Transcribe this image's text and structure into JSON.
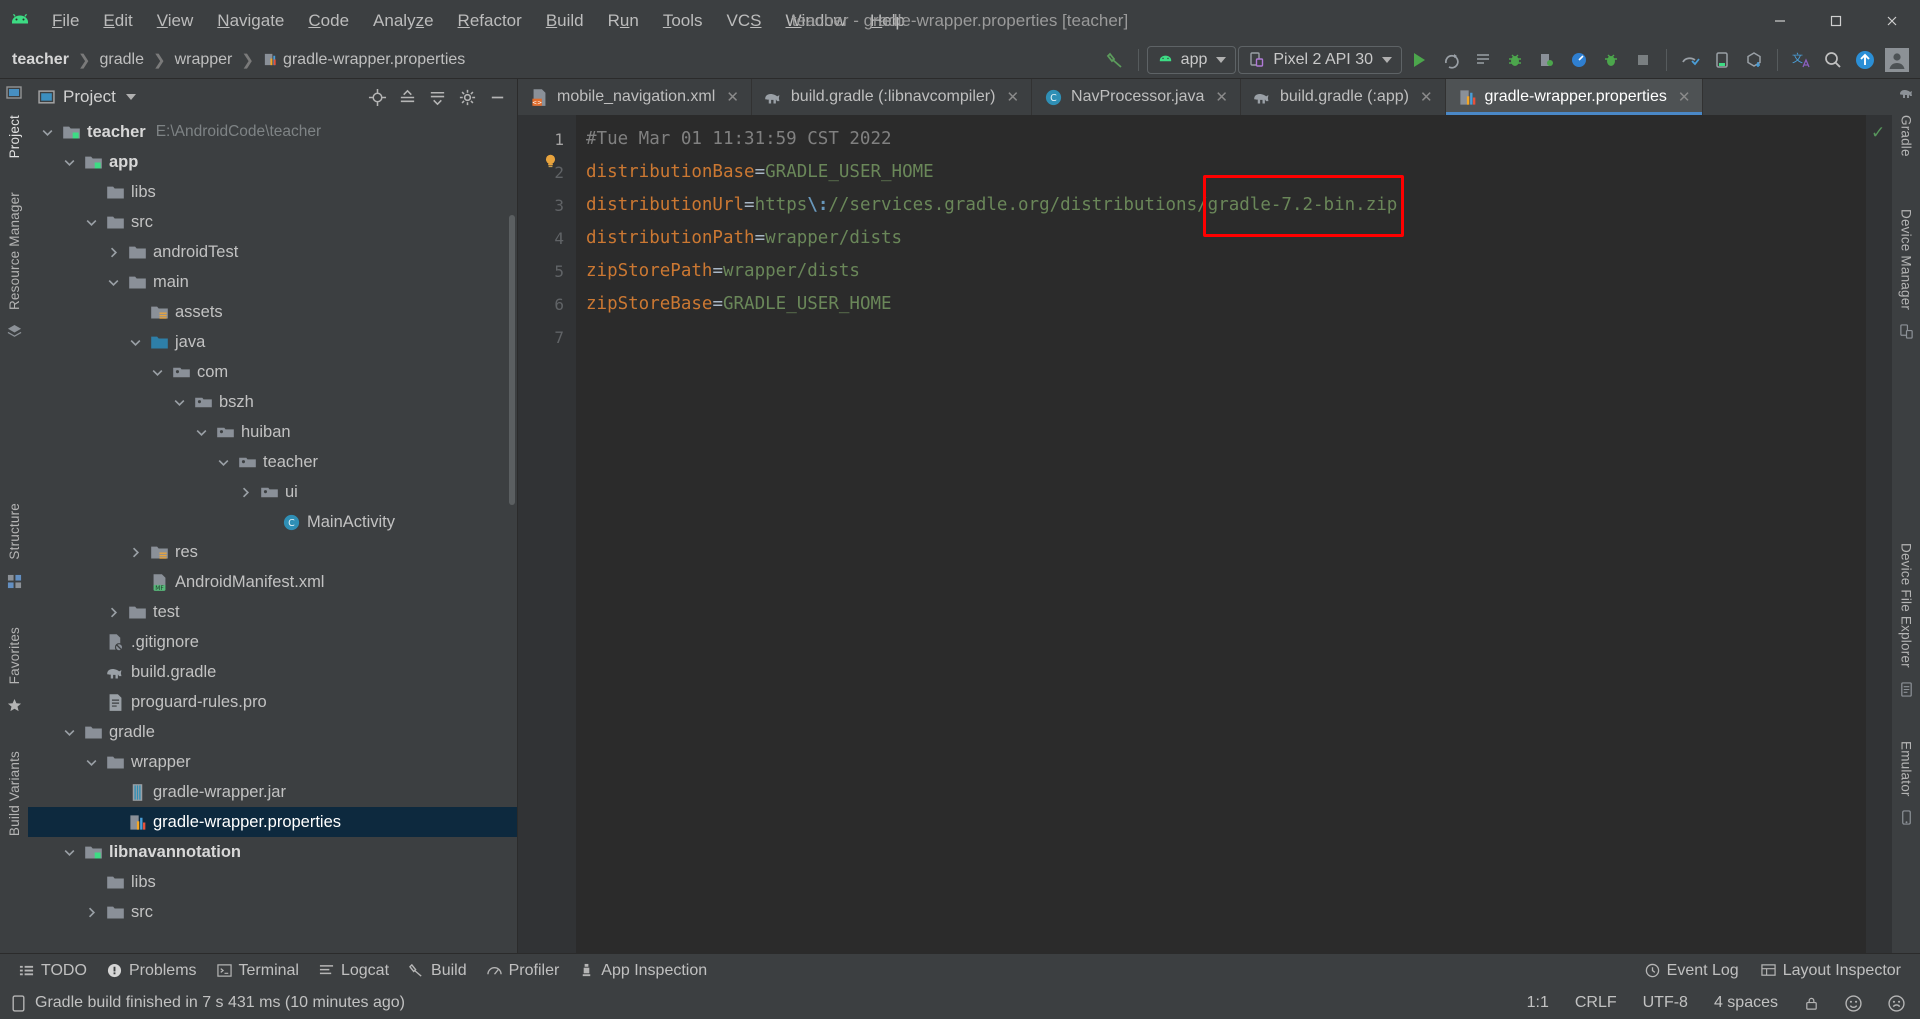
{
  "window": {
    "title": "teacher - gradle-wrapper.properties [teacher]",
    "minimize": "–",
    "maximize": "▢",
    "close": "✕"
  },
  "menubar": {
    "logo": "android-logo-icon",
    "items": [
      {
        "label": "File",
        "mnemonic": "F"
      },
      {
        "label": "Edit",
        "mnemonic": "E"
      },
      {
        "label": "View",
        "mnemonic": "V"
      },
      {
        "label": "Navigate",
        "mnemonic": "N"
      },
      {
        "label": "Code",
        "mnemonic": "C"
      },
      {
        "label": "Analyze",
        "mnemonic": "z"
      },
      {
        "label": "Refactor",
        "mnemonic": "R"
      },
      {
        "label": "Build",
        "mnemonic": "B"
      },
      {
        "label": "Run",
        "mnemonic": "u"
      },
      {
        "label": "Tools",
        "mnemonic": "T"
      },
      {
        "label": "VCS",
        "mnemonic": "S"
      },
      {
        "label": "Window",
        "mnemonic": "W"
      },
      {
        "label": "Help",
        "mnemonic": "H"
      }
    ]
  },
  "navbar": {
    "breadcrumb": [
      {
        "label": "teacher",
        "icon": null
      },
      {
        "label": "gradle",
        "icon": null
      },
      {
        "label": "wrapper",
        "icon": null
      },
      {
        "label": "gradle-wrapper.properties",
        "icon": "properties-file-icon"
      }
    ],
    "separator": "❯",
    "run_config": {
      "label": "app",
      "icon": "android-app-icon"
    },
    "device": {
      "label": "Pixel 2 API 30",
      "icon": "device-icon"
    },
    "icons": [
      "build-hammer-icon",
      "run-icon",
      "apply-changes-icon",
      "apply-code-changes-icon",
      "debug-icon",
      "attach-debugger-icon",
      "profiler-icon",
      "layout-inspector-icon",
      "stop-icon",
      "avd-manager-icon",
      "sdk-manager-icon",
      "project-structure-icon",
      "translate-icon",
      "search-icon",
      "update-icon",
      "avatar-icon"
    ]
  },
  "left_rail": {
    "items": [
      {
        "label": "Project",
        "active": true
      },
      {
        "label": "Resource Manager",
        "active": false
      },
      {
        "label": "Structure",
        "active": false
      },
      {
        "label": "Favorites",
        "active": false
      },
      {
        "label": "Build Variants",
        "active": false
      }
    ]
  },
  "right_rail": {
    "items": [
      {
        "label": "Gradle"
      },
      {
        "label": "Device Manager"
      },
      {
        "label": "Device File Explorer"
      },
      {
        "label": "Emulator"
      }
    ]
  },
  "project_panel": {
    "title": "Project",
    "title_caret": "▾",
    "tools": [
      "locate-icon",
      "expand-all-icon",
      "collapse-all-icon",
      "settings-gear-icon",
      "hide-icon"
    ],
    "tree": [
      {
        "indent": 0,
        "twisty": "down",
        "icon": "module-folder-icon",
        "label": "teacher",
        "bold": true,
        "sub": "E:\\AndroidCode\\teacher",
        "selected": false
      },
      {
        "indent": 1,
        "twisty": "down",
        "icon": "module-folder-icon",
        "label": "app",
        "bold": true,
        "sub": "",
        "selected": false
      },
      {
        "indent": 2,
        "twisty": "none",
        "icon": "folder-icon",
        "label": "libs",
        "bold": false,
        "sub": "",
        "selected": false
      },
      {
        "indent": 2,
        "twisty": "down",
        "icon": "folder-icon",
        "label": "src",
        "bold": false,
        "sub": "",
        "selected": false
      },
      {
        "indent": 3,
        "twisty": "right",
        "icon": "folder-icon",
        "label": "androidTest",
        "bold": false,
        "sub": "",
        "selected": false
      },
      {
        "indent": 3,
        "twisty": "down",
        "icon": "folder-icon",
        "label": "main",
        "bold": false,
        "sub": "",
        "selected": false
      },
      {
        "indent": 4,
        "twisty": "none",
        "icon": "assets-folder-icon",
        "label": "assets",
        "bold": false,
        "sub": "",
        "selected": false
      },
      {
        "indent": 4,
        "twisty": "down",
        "icon": "source-folder-icon",
        "label": "java",
        "bold": false,
        "sub": "",
        "selected": false
      },
      {
        "indent": 5,
        "twisty": "down",
        "icon": "package-icon",
        "label": "com",
        "bold": false,
        "sub": "",
        "selected": false
      },
      {
        "indent": 6,
        "twisty": "down",
        "icon": "package-icon",
        "label": "bszh",
        "bold": false,
        "sub": "",
        "selected": false
      },
      {
        "indent": 7,
        "twisty": "down",
        "icon": "package-icon",
        "label": "huiban",
        "bold": false,
        "sub": "",
        "selected": false
      },
      {
        "indent": 8,
        "twisty": "down",
        "icon": "package-icon",
        "label": "teacher",
        "bold": false,
        "sub": "",
        "selected": false
      },
      {
        "indent": 9,
        "twisty": "right",
        "icon": "package-icon",
        "label": "ui",
        "bold": false,
        "sub": "",
        "selected": false
      },
      {
        "indent": 10,
        "twisty": "none",
        "icon": "java-class-icon",
        "label": "MainActivity",
        "bold": false,
        "sub": "",
        "selected": false
      },
      {
        "indent": 4,
        "twisty": "right",
        "icon": "res-folder-icon",
        "label": "res",
        "bold": false,
        "sub": "",
        "selected": false
      },
      {
        "indent": 4,
        "twisty": "none",
        "icon": "manifest-file-icon",
        "label": "AndroidManifest.xml",
        "bold": false,
        "sub": "",
        "selected": false
      },
      {
        "indent": 3,
        "twisty": "right",
        "icon": "folder-icon",
        "label": "test",
        "bold": false,
        "sub": "",
        "selected": false
      },
      {
        "indent": 2,
        "twisty": "none",
        "icon": "gitignore-file-icon",
        "label": ".gitignore",
        "bold": false,
        "sub": "",
        "selected": false
      },
      {
        "indent": 2,
        "twisty": "none",
        "icon": "gradle-file-icon",
        "label": "build.gradle",
        "bold": false,
        "sub": "",
        "selected": false
      },
      {
        "indent": 2,
        "twisty": "none",
        "icon": "text-file-icon",
        "label": "proguard-rules.pro",
        "bold": false,
        "sub": "",
        "selected": false
      },
      {
        "indent": 1,
        "twisty": "down",
        "icon": "folder-icon",
        "label": "gradle",
        "bold": false,
        "sub": "",
        "selected": false
      },
      {
        "indent": 2,
        "twisty": "down",
        "icon": "folder-icon",
        "label": "wrapper",
        "bold": false,
        "sub": "",
        "selected": false
      },
      {
        "indent": 3,
        "twisty": "none",
        "icon": "jar-file-icon",
        "label": "gradle-wrapper.jar",
        "bold": false,
        "sub": "",
        "selected": false
      },
      {
        "indent": 3,
        "twisty": "none",
        "icon": "properties-file-icon",
        "label": "gradle-wrapper.properties",
        "bold": false,
        "sub": "",
        "selected": true
      },
      {
        "indent": 1,
        "twisty": "down",
        "icon": "module-folder-icon",
        "label": "libnavannotation",
        "bold": true,
        "sub": "",
        "selected": false
      },
      {
        "indent": 2,
        "twisty": "none",
        "icon": "folder-icon",
        "label": "libs",
        "bold": false,
        "sub": "",
        "selected": false
      },
      {
        "indent": 2,
        "twisty": "right",
        "icon": "folder-icon",
        "label": "src",
        "bold": false,
        "sub": "",
        "selected": false
      }
    ]
  },
  "editor": {
    "tabs": [
      {
        "label": "mobile_navigation.xml",
        "icon": "xml-file-icon",
        "active": false,
        "close": "✕"
      },
      {
        "label": "build.gradle (:libnavcompiler)",
        "icon": "gradle-file-icon",
        "active": false,
        "close": "✕"
      },
      {
        "label": "NavProcessor.java",
        "icon": "java-class-icon",
        "active": false,
        "close": "✕"
      },
      {
        "label": "build.gradle (:app)",
        "icon": "gradle-file-icon",
        "active": false,
        "close": "✕"
      },
      {
        "label": "gradle-wrapper.properties",
        "icon": "properties-file-icon",
        "active": true,
        "close": "✕"
      }
    ],
    "line_numbers": [
      "1",
      "2",
      "3",
      "4",
      "5",
      "6",
      "7"
    ],
    "lines": [
      {
        "n": 1,
        "comment": "#Tue Mar 01 11:31:59 CST 2022"
      },
      {
        "n": 2,
        "key": "distributionBase",
        "eq": "=",
        "value": "GRADLE_USER_HOME"
      },
      {
        "n": 3,
        "key": "distributionUrl",
        "eq": "=",
        "value_pre": "https",
        "escape": "\\:",
        "value_post": "//services.gradle.org/distributions/",
        "highlighted": "gradle-7.2-bin.zip"
      },
      {
        "n": 4,
        "key": "distributionPath",
        "eq": "=",
        "value": "wrapper/dists"
      },
      {
        "n": 5,
        "key": "zipStorePath",
        "eq": "=",
        "value": "wrapper/dists"
      },
      {
        "n": 6,
        "key": "zipStoreBase",
        "eq": "=",
        "value": "GRADLE_USER_HOME"
      },
      {
        "n": 7,
        "comment": ""
      }
    ],
    "inspection_ok": "✓",
    "bulb": "intention-bulb-icon",
    "highlight_color": "#ff0000"
  },
  "bottom_bar": {
    "items": [
      {
        "label": "TODO",
        "icon": "todo-icon"
      },
      {
        "label": "Problems",
        "icon": "problems-icon"
      },
      {
        "label": "Terminal",
        "icon": "terminal-icon"
      },
      {
        "label": "Logcat",
        "icon": "logcat-icon"
      },
      {
        "label": "Build",
        "icon": "build-icon"
      },
      {
        "label": "Profiler",
        "icon": "profiler-icon"
      },
      {
        "label": "App Inspection",
        "icon": "app-inspection-icon"
      }
    ],
    "right_items": [
      {
        "label": "Event Log",
        "icon": "event-log-icon"
      },
      {
        "label": "Layout Inspector",
        "icon": "layout-inspector-icon"
      }
    ]
  },
  "status_bar": {
    "message": "Gradle build finished in 7 s 431 ms (10 minutes ago)",
    "message_icon": "build-status-icon",
    "caret_position": "1:1",
    "line_separator": "CRLF",
    "encoding": "UTF-8",
    "indent": "4 spaces",
    "lock_icon": "lock-icon",
    "smiley_icon": "feedback-happy-icon",
    "frown_icon": "feedback-sad-icon"
  },
  "colors": {
    "accent_blue": "#4a88c7",
    "selection_blue": "#0d293e",
    "panel_bg": "#3c3f41",
    "editor_bg": "#2b2b2b",
    "gutter_bg": "#313335",
    "key_orange": "#cc7832",
    "value_green": "#6a8759",
    "comment_gray": "#808080",
    "escape_blue": "#6897bb",
    "highlight_red": "#ff0000"
  }
}
